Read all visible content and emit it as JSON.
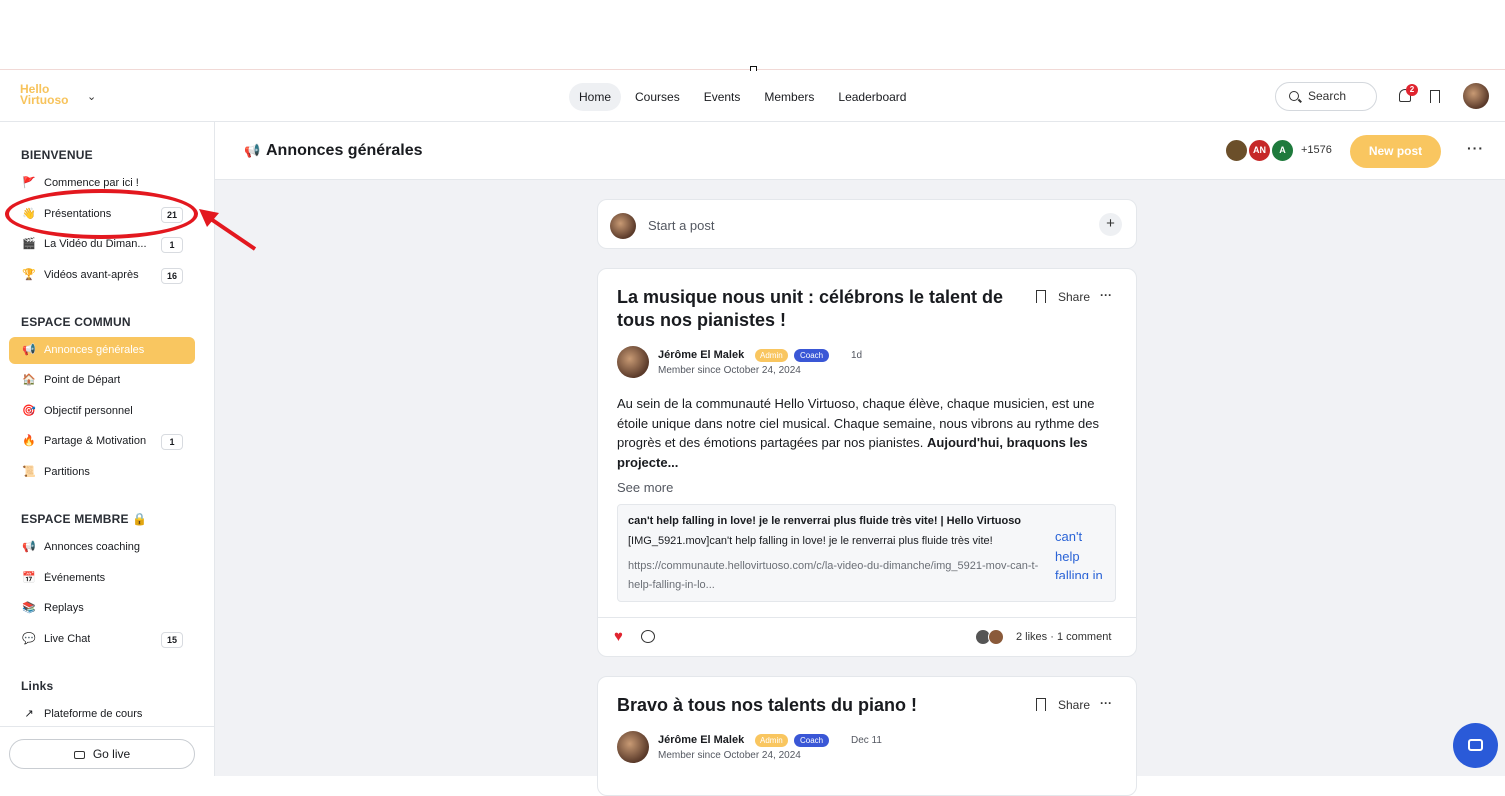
{
  "brand": {
    "logo_line1": "Hello",
    "logo_line2": "Virtuoso",
    "chevron": "chevron-down-icon",
    "accent": "#f9c660"
  },
  "nav": {
    "items": [
      "Home",
      "Courses",
      "Events",
      "Members",
      "Leaderboard"
    ],
    "active": "Home"
  },
  "search": {
    "label": "Search"
  },
  "notifications": {
    "count": "2"
  },
  "sidebar": {
    "sections": [
      {
        "title": "BIENVENUE",
        "items": [
          {
            "icon": "🚩",
            "label": "Commence par ici !",
            "count": ""
          },
          {
            "icon": "👋",
            "label": "Présentations",
            "count": "21"
          },
          {
            "icon": "🎬",
            "label": "La Vidéo du Diman...",
            "count": "1"
          },
          {
            "icon": "🏆",
            "label": "Vidéos avant-après",
            "count": "16"
          }
        ]
      },
      {
        "title": "ESPACE COMMUN",
        "items": [
          {
            "icon": "📢",
            "label": "Annonces générales",
            "count": ""
          },
          {
            "icon": "🏠",
            "label": "Point de Départ",
            "count": ""
          },
          {
            "icon": "🎯",
            "label": "Objectif personnel",
            "count": ""
          },
          {
            "icon": "🔥",
            "label": "Partage & Motivation",
            "count": "1"
          },
          {
            "icon": "📜",
            "label": "Partitions",
            "count": ""
          }
        ]
      },
      {
        "title": "ESPACE MEMBRE 🔒",
        "items": [
          {
            "icon": "📢",
            "label": "Annonces coaching",
            "count": ""
          },
          {
            "icon": "📅",
            "label": "Événements",
            "count": ""
          },
          {
            "icon": "📚",
            "label": "Replays",
            "count": ""
          },
          {
            "icon": "💬",
            "label": "Live Chat",
            "count": "15"
          }
        ]
      },
      {
        "title": "Links",
        "items": [
          {
            "icon": "↗",
            "label": "Plateforme de cours",
            "count": ""
          }
        ]
      }
    ],
    "go_live": "Go live"
  },
  "space": {
    "icon": "📢",
    "title": "Annonces générales",
    "member_initials": [
      "",
      "AN",
      "A"
    ],
    "member_colors": [
      "#6b4f2a",
      "#c62828",
      "#1e7a3c"
    ],
    "more_members": "+1576",
    "new_post": "New post"
  },
  "composer": {
    "placeholder": "Start a post"
  },
  "posts": [
    {
      "title": "La musique nous unit : célébrons le talent de tous nos pianistes !",
      "share": "Share",
      "author": "Jérôme El Malek",
      "admin_badge": "Admin",
      "coach_badge": "Coach",
      "time": "1d",
      "since": "Member since October 24, 2024",
      "body": "Au sein de la communauté Hello Virtuoso, chaque élève, chaque musicien, est une étoile unique dans notre ciel musical. Chaque semaine, nous vibrons au rythme des progrès et des émotions partagées par nos pianistes. ",
      "body_bold": "Aujourd'hui, braquons les projecte...",
      "see_more": "See more",
      "link_title": "can't help falling in love! je le renverrai plus fluide très vite! | Hello Virtuoso",
      "link_desc": "[IMG_5921.mov]can't help falling in love! je le renverrai plus fluide très vite!",
      "link_url": "https://communaute.hellovirtuoso.com/c/la-video-du-dimanche/img_5921-mov-can-t-help-falling-in-lo...",
      "link_img_alt": "can't help falling in lo",
      "likes": "2 likes",
      "comments": "1 comment"
    },
    {
      "title": "Bravo à tous nos talents du piano !",
      "share": "Share",
      "author": "Jérôme El Malek",
      "admin_badge": "Admin",
      "coach_badge": "Coach",
      "time": "Dec 11",
      "since": "Member since October 24, 2024"
    }
  ]
}
